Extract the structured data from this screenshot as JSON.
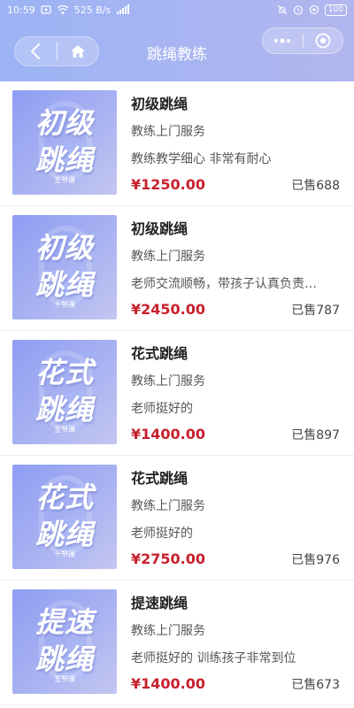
{
  "status_bar": {
    "time": "10:59",
    "network_speed": "525 B/s",
    "network_type": "4G",
    "battery": "100"
  },
  "navbar": {
    "title": "跳绳教练"
  },
  "products": [
    {
      "thumb_line1": "初级",
      "thumb_line2": "跳绳",
      "thumb_sub": "五节课",
      "title": "初级跳绳",
      "service": "教练上门服务",
      "description": "教练教学细心 非常有耐心",
      "price": "¥1250.00",
      "sold": "已售688"
    },
    {
      "thumb_line1": "初级",
      "thumb_line2": "跳绳",
      "thumb_sub": "十节课",
      "title": "初级跳绳",
      "service": "教练上门服务",
      "description": "老师交流顺畅，带孩子认真负责…",
      "price": "¥2450.00",
      "sold": "已售787"
    },
    {
      "thumb_line1": "花式",
      "thumb_line2": "跳绳",
      "thumb_sub": "五节课",
      "title": "花式跳绳",
      "service": "教练上门服务",
      "description": "老师挺好的",
      "price": "¥1400.00",
      "sold": "已售897"
    },
    {
      "thumb_line1": "花式",
      "thumb_line2": "跳绳",
      "thumb_sub": "十节课",
      "title": "花式跳绳",
      "service": "教练上门服务",
      "description": "老师挺好的",
      "price": "¥2750.00",
      "sold": "已售976"
    },
    {
      "thumb_line1": "提速",
      "thumb_line2": "跳绳",
      "thumb_sub": "五节课",
      "title": "提速跳绳",
      "service": "教练上门服务",
      "description": "老师挺好的 训练孩子非常到位",
      "price": "¥1400.00",
      "sold": "已售673"
    }
  ],
  "colors": {
    "header_gradient_start": "#9cb3f4",
    "header_gradient_end": "#b2b6ee",
    "price": "#c7202d"
  }
}
